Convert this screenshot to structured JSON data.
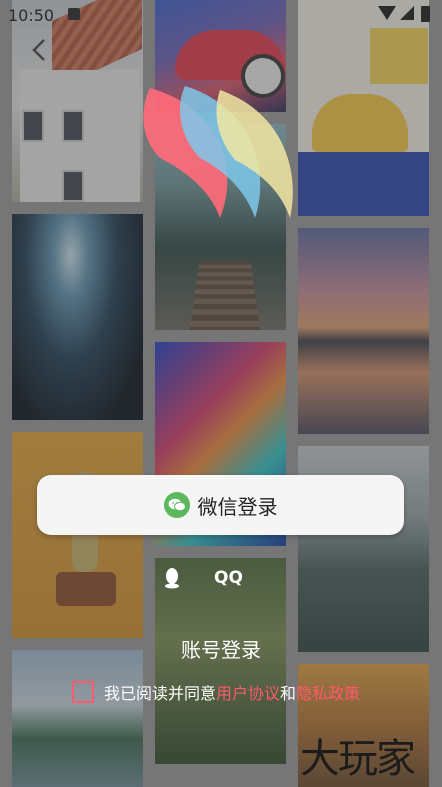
{
  "status_bar": {
    "time": "10:50",
    "icons": [
      "notification-icon",
      "wifi-icon",
      "signal-icon",
      "battery-icon"
    ]
  },
  "nav": {
    "back_icon": "chevron-left-icon"
  },
  "logo": {
    "colors": [
      "#ff6a7a",
      "#7ec8ea",
      "#f2e6a2"
    ]
  },
  "login": {
    "wechat_label": "微信登录",
    "qq_label": "QQ",
    "account_label": "账号登录"
  },
  "agreement": {
    "prefix": "我已阅读并同意",
    "user_agreement": "用户协议",
    "and": "和",
    "privacy_policy": "隐私政策",
    "checked": false
  },
  "watermark": "大玩家",
  "colors": {
    "accent": "#ff5a6e",
    "wechat_green": "#5cb85c"
  }
}
